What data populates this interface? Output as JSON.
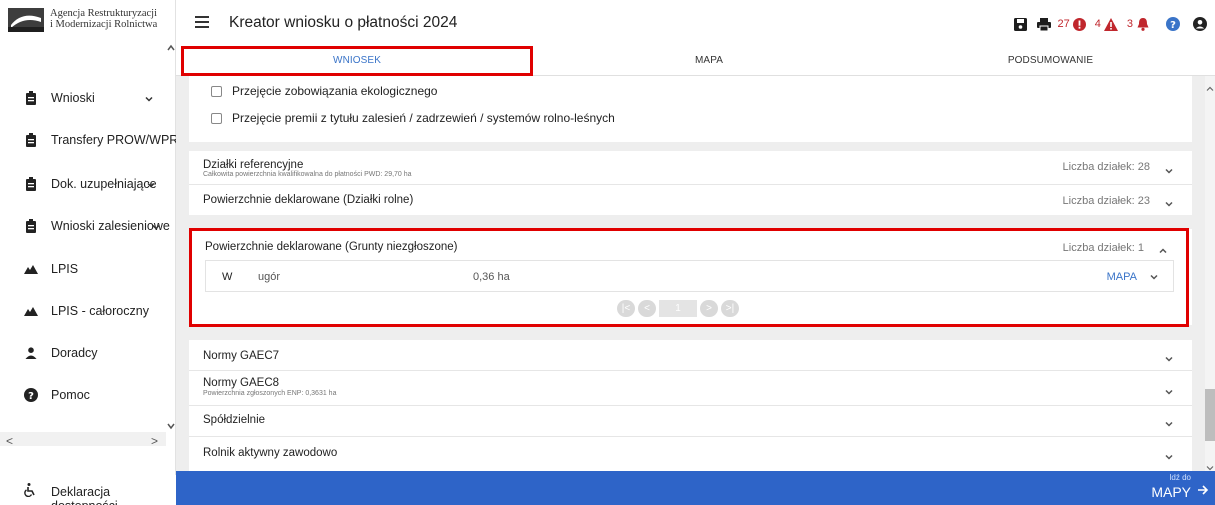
{
  "logo": {
    "line1": "Agencja Restrukturyzacji",
    "line2": "i Modernizacji Rolnictwa"
  },
  "sidebar": {
    "items": [
      {
        "label": "Wnioski",
        "icon": "clipboard-icon",
        "has_chevron": true
      },
      {
        "label": "Transfery PROW/WPR",
        "icon": "clipboard-icon",
        "has_chevron": false
      },
      {
        "label": "Dok. uzupełniające",
        "icon": "clipboard-icon",
        "has_chevron": true
      },
      {
        "label": "Wnioski zalesieniowe",
        "icon": "clipboard-icon",
        "has_chevron": true
      },
      {
        "label": "LPIS",
        "icon": "mountain-icon",
        "has_chevron": false
      },
      {
        "label": "LPIS - całoroczny",
        "icon": "mountain-icon",
        "has_chevron": false
      },
      {
        "label": "Doradcy",
        "icon": "person-icon",
        "has_chevron": false
      },
      {
        "label": "Pomoc",
        "icon": "question-circle-icon",
        "has_chevron": false
      }
    ],
    "footer_label": "Deklaracja dostępności"
  },
  "header": {
    "title": "Kreator wniosku o płatności 2024",
    "errors_count": "27",
    "warnings_count": "4",
    "notifications_count": "3"
  },
  "tabs": [
    {
      "label": "WNIOSEK",
      "active": true
    },
    {
      "label": "MAPA",
      "active": false
    },
    {
      "label": "PODSUMOWANIE",
      "active": false
    }
  ],
  "checkboxes": [
    {
      "label": "Przejęcie zobowiązania ekologicznego",
      "checked": false
    },
    {
      "label": "Przejęcie premii z tytułu zalesień / zadrzewień / systemów rolno-leśnych",
      "checked": false
    }
  ],
  "panels": {
    "dzialki": {
      "title": "Działki referencyjne",
      "subtitle": "Całkowita powierzchnia kwalifikowalna do płatności PWD: 29,70 ha",
      "count": "Liczba działek: 28"
    },
    "rolne": {
      "title": "Powierzchnie deklarowane (Działki rolne)",
      "count": "Liczba działek: 23"
    },
    "grunty": {
      "title": "Powierzchnie deklarowane (Grunty niezgłoszone)",
      "count": "Liczba działek: 1",
      "row": {
        "code": "W",
        "type": "ugór",
        "area": "0,36 ha",
        "map_link": "MAPA"
      },
      "pager": {
        "page": "1"
      }
    },
    "gaec7": {
      "title": "Normy GAEC7"
    },
    "gaec8": {
      "title": "Normy GAEC8",
      "subtitle": "Powierzchnia zgłoszonych ENP: 0,3631 ha"
    },
    "spoldzielnie": {
      "title": "Spółdzielnie"
    },
    "rolnik": {
      "title": "Rolnik aktywny zawodowo"
    }
  },
  "bottom": {
    "goto_small": "Idź do",
    "goto_big": "MAPY"
  },
  "colors": {
    "primary": "#2e64c8",
    "highlight": "#e00000",
    "error": "#c0272d",
    "help": "#3a74c8"
  }
}
